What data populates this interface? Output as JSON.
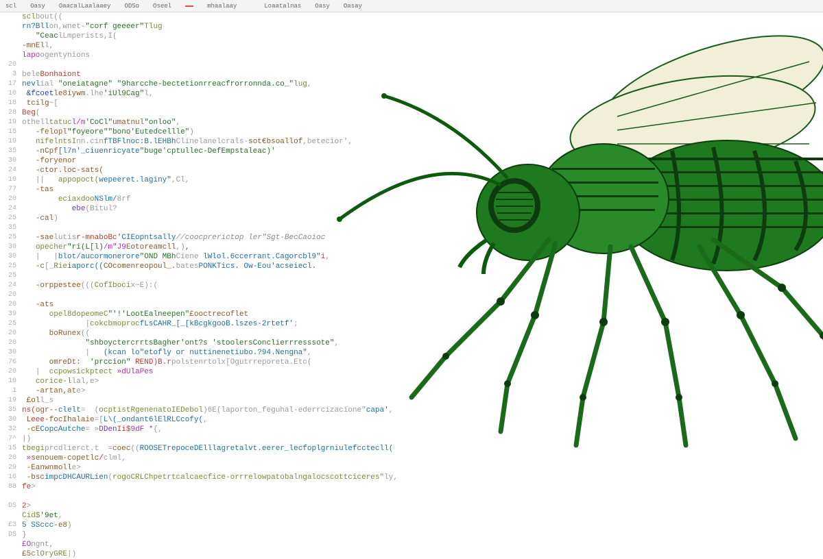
{
  "toolbar": {
    "items": [
      "scl",
      "Oasy",
      "OaacalLaalaaey",
      "ODSo",
      "Oseel",
      "",
      "mhaalaay",
      "",
      "Loaatalnas",
      "Oasy",
      "Oasay"
    ]
  },
  "code": [
    {
      "n": "",
      "html": "<span class='kw'>scl</span><span class='dim'>bout((</span>"
    },
    {
      "n": "",
      "html": "<span class='fn'>rn?Bll</span><span class='dim'>on,wnet-</span><span class='str'>\"corf geeeer\"</span><span class='kw'>Tlug</span>"
    },
    {
      "n": "",
      "html": "   <span class='str'>\"Ceac</span><span class='dim'>lLmperists,I(</span>"
    },
    {
      "n": "",
      "html": "<span class='brn'>-mnEl</span><span class='dim'>l,</span>"
    },
    {
      "n": "",
      "html": "<span class='mag'>lapo</span><span class='dim'>ogentynions</span>"
    },
    {
      "n": "20",
      "html": ""
    },
    {
      "n": "3",
      "html": "<span class='dim'>bele</span><span class='red'>Bonhaiont</span>"
    },
    {
      "n": "17",
      "html": "<span class='fn'>nevl</span><span class='dim'>ial</span> <span class='str'>\"oneiatagne\"</span> <span class='str'>\"9harcche-bectetionrreacfrorronnda.co_\"</span><span class='kw'>lug</span><span class='dim'>,</span>"
    },
    {
      "n": "10",
      "html": " <span class='blu'>&amp;fcoet</span><span class='brn'>le8iywm</span><span class='dim'>.lhe</span><span class='str'>'iUl9Cag\"</span><span class='dim'>l,</span>"
    },
    {
      "n": "18",
      "html": " <span class='brn'>tcilg</span><span class='dim'>~[</span>"
    },
    {
      "n": "28",
      "html": "<span class='red'>Beg</span><span class='dim'>(</span>"
    },
    {
      "n": "19",
      "html": "<span class='dim'>othell</span><span class='kw'>tatuc</span><span class='mag'>l/m</span><span class='str'>'CoCl\"</span><span class='brn'>umatnul</span><span class='str'>\"onloo\"</span><span class='dim'>,</span>"
    },
    {
      "n": "15",
      "html": "   <span class='brn'>-felopl</span><span class='str'>\"foyeore\"</span><span class='str'>\"bono'Eutedcellle\"</span><span class='dim'>)</span>"
    },
    {
      "n": "19",
      "html": "   <span class='kw'>nifelntsI</span><span class='dim'>nn.cin</span><span class='fn'>fTBFlnoc:B.lEHBh</span><span class='dim'>Clinelanelcrals-</span><span class='brn'>sot€bsoallof</span><span class='dim'>,betecior',</span>"
    },
    {
      "n": "35",
      "html": "   <span class='brn'>-nCpf</span><span class='fn'>[l7n'_ciuenricyate</span><span class='str'>\"buge'cptullec-DefEmpstaleac)'</span>"
    },
    {
      "n": "30",
      "html": "   <span class='brn'>-foryenor</span>"
    },
    {
      "n": "24",
      "html": "   <span class='brn'>-ctor.loc-sats(</span>"
    },
    {
      "n": "10",
      "html": "   <span class='dim'>||   </span><span class='kw'>appopoct(</span><span class='fn'>wepeeret.laginy\"</span><span class='dim'>,Cl,</span>"
    },
    {
      "n": "77",
      "html": "   <span class='brn'>-tas</span>"
    },
    {
      "n": "20",
      "html": "        <span class='kw'>eciaxdoo</span><span class='fn'>NSlm/</span><span class='dim'>8rf</span>"
    },
    {
      "n": "24",
      "html": "           <span class='pur'>ebe</span><span class='dim'>(Bitul?</span>"
    },
    {
      "n": "25",
      "html": "   <span class='brn'>-cal</span><span class='dim'>)</span>"
    },
    {
      "n": "35",
      "html": ""
    },
    {
      "n": "25",
      "html": "   <span class='brn'>-sae</span><span class='dim'>lutis</span><span class='red'>r-mnaboBc'</span><span class='fn'>CIEopntsally</span><span class='com'>//coocprerictop ler\"Sgt-BecCaoioc</span>"
    },
    {
      "n": "30",
      "html": "   <span class='kw'>opecher</span><span class='str'>\"ri(L[l)</span><span class='mag'>/m\"J9</span><span class='brn'>Eotoreamcll</span><span class='dim'>,)</span><span class='red'>,</span>"
    },
    {
      "n": "30",
      "html": "   <span class='dim'>|   |</span><span class='fn'>blot/aucormonerore</span><span class='str'>\"OND MBh</span><span class='dim'>Ciene </span><span class='fn'>lWlol.6ccerrant.Cagorcbl9\"</span><span class='red'>i</span><span class='dim'>,</span>"
    },
    {
      "n": "25",
      "html": "   <span class='brn'>-c</span><span class='dim'>[_</span><span class='kw'>Rie</span><span class='fn'>iaporc((</span><span class='brn'>COcomenreopoul_.</span><span class='dim'>bates</span><span class='fn'>PONKTics. Ow-Eou'acseiecl.</span>"
    },
    {
      "n": "25",
      "html": ""
    },
    {
      "n": "24",
      "html": "   <span class='brn'>-orppestee</span><span class='dim'>(((</span><span class='kw'>CofIboci</span><span class='dim'>x~E):(</span>"
    },
    {
      "n": "20",
      "html": ""
    },
    {
      "n": "20",
      "html": "   <span class='brn'>-ats</span>"
    },
    {
      "n": "39",
      "html": "      <span class='kw'>opel8dopeomeC</span><span class='str'>\"'!'LootEalneepen\"</span><span class='brn'>£ooctrecoflet</span>"
    },
    {
      "n": "25",
      "html": "              <span class='dim'>|</span><span class='kw'>cokcbmoproc</span><span class='fn'>fLsCAHR_[_[kBcgkgooB.lszes-2rtetf'</span><span class='dim'>;</span>"
    },
    {
      "n": "20",
      "html": "   <span class='dim'>   </span><span class='brn'>boRunex</span><span class='dim'>((</span>"
    },
    {
      "n": "20",
      "html": "              <span class='str'>\"shboyctercrrtsBagher'ont?s 'stoolersConclierrresssote\"</span><span class='dim'>,</span>"
    },
    {
      "n": "30",
      "html": "              <span class='dim'>|   </span><span class='fn'>(kcan lo\"etofly or nuttinenetiubo.?94.Nengna\"</span><span class='dim'>,</span>"
    },
    {
      "n": "76",
      "html": "      <span class='brn'>omreDt:</span>  <span class='str'>'prccion\"</span><span class='red'> REND)B.r</span><span class='dim'>polstenrtolx[Ogutrreporeta.Etc(</span>"
    },
    {
      "n": "20",
      "html": "   <span class='dim'>|  </span><span class='kw'>ccpowsickptect</span> <span class='mag'>»dUlaPes</span>"
    },
    {
      "n": "10",
      "html": "   <span class='kw'>corice-l</span><span class='dim'>lal,e></span>"
    },
    {
      "n": "1",
      "html": "   <span class='brn'>-artan,at</span><span class='dim'>e></span>"
    },
    {
      "n": "19",
      "html": " <span class='brn'>£ol</span><span class='dim'>l_s</span>"
    },
    {
      "n": "35",
      "html": "<span class='red'>ns(</span><span class='brn'>ogr--</span><span class='fn'>clelt</span><span class='dim'>=  (</span><span class='kw'>ocptistRgenenatoIEDebol</span><span class='dim'>)6E(laporton_feguhal-ederrcizacione\"</span><span class='fn'>capa'</span><span class='dim'>,</span>"
    },
    {
      "n": "30",
      "html": " <span class='red'>Leee-</span><span class='brn'>focIhalaie</span><span class='dim'>=[</span><span class='fn'>L\\(_ondant6lElRLCcofy(</span><span class='dim'>,</span>"
    },
    {
      "n": "32",
      "html": " <span class='brn'>-cE</span><span class='fn'>CopcAutche</span><span class='dim'>= »</span><span class='pur'>DDen</span><span class='red'>Ii$</span><span class='mag'>9dF *</span><span class='dim'>{,</span>"
    },
    {
      "n": "7^",
      "html": "<span class='dim'>|)</span>"
    },
    {
      "n": "15",
      "html": "<span class='kw'>tbegi</span><span class='dim'>prcdlierct.t  =</span><span class='brn'>coec</span><span class='dim'>((</span><span class='fn'>ROOSETrepoceDElllagretalvt.eerer_lecfoplgrniulefcctecll(</span>"
    },
    {
      "n": "20",
      "html": " <span class='mag'>»</span><span class='brn'>senouem-copetlc</span><span class='red'>/</span><span class='dim'>clml,</span>"
    },
    {
      "n": "29",
      "html": " <span class='brn'>-Eanwnmoll</span><span class='dim'>e></span>"
    },
    {
      "n": "16",
      "html": " <span class='brn'>-bsc</span><span class='fn'>impcDHCAURLien</span><span class='dim'>(</span><span class='kw'>rogoCRLChpetrtcalcaecfice-orrrelowpatobalngalocscottciceres\"</span><span class='dim'>ly,</span>"
    },
    {
      "n": "88",
      "html": "<span class='red'>fe</span><span class='dim'>></span>"
    },
    {
      "n": "",
      "html": ""
    },
    {
      "n": "DS",
      "html": "<span class='red'>2</span><span class='dim'>></span>"
    },
    {
      "n": "",
      "html": "<span class='kw'>Cid$</span><span class='str'>'9et</span><span class='dim'>,</span>"
    },
    {
      "n": "£3",
      "html": "<span class='fn'>5 SSccc</span><span class='brn'>-e8</span><span class='dim'>)</span>"
    },
    {
      "n": "DS",
      "html": "<span class='dim'>}</span>"
    },
    {
      "n": "",
      "html": "<span class='mag'>£O</span><span class='dim'>ngnt,</span>"
    },
    {
      "n": "",
      "html": "<span class='brn'>£5</span><span class='kw'>clOryGRE</span><span class='dim'>|)</span>"
    }
  ]
}
